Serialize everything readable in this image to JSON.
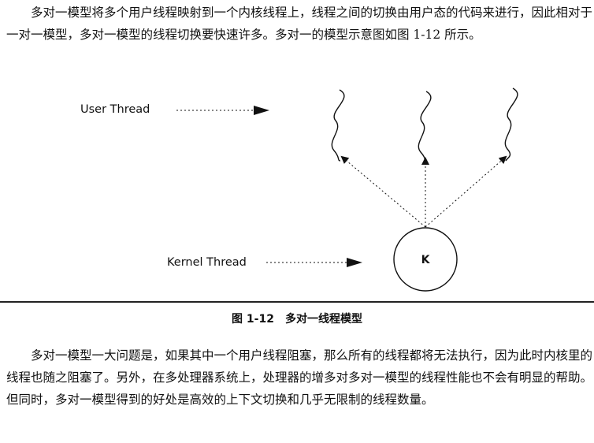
{
  "paragraphs": {
    "intro": "多对一模型将多个用户线程映射到一个内核线程上，线程之间的切换由用户态的代码来进行，因此相对于一对一模型，多对一模型的线程切换要快速许多。多对一的模型示意图如图 1-12 所示。",
    "body": "多对一模型一大问题是，如果其中一个用户线程阻塞，那么所有的线程都将无法执行，因为此时内核里的线程也随之阻塞了。另外，在多处理器系统上，处理器的增多对多对一模型的线程性能也不会有明显的帮助。但同时，多对一模型得到的好处是高效的上下文切换和几乎无限制的线程数量。"
  },
  "figure": {
    "user_thread_label": "User Thread",
    "kernel_thread_label": "Kernel Thread",
    "kernel_node_label": "K",
    "caption": "图 1-12　多对一线程模型"
  }
}
